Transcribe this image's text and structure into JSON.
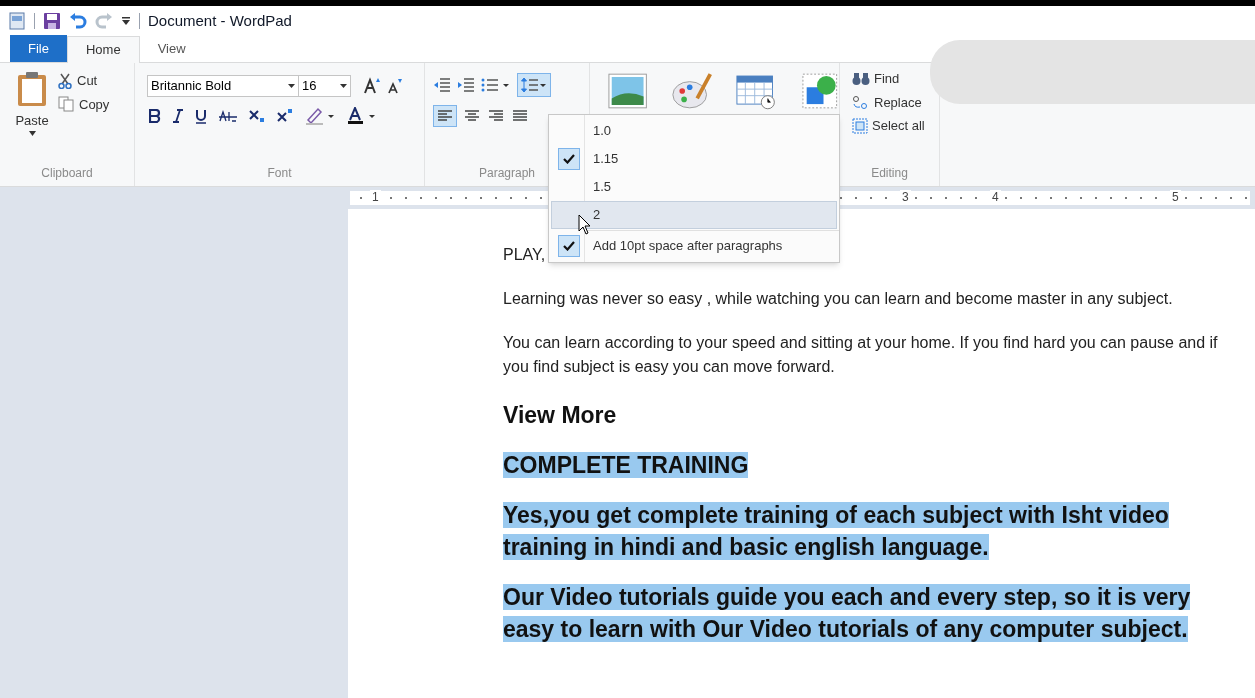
{
  "window": {
    "title": "Document - WordPad"
  },
  "tabs": [
    {
      "label": "File",
      "kind": "file",
      "selected": false
    },
    {
      "label": "Home",
      "kind": "tab",
      "selected": true
    },
    {
      "label": "View",
      "kind": "tab",
      "selected": false
    }
  ],
  "ribbon": {
    "clipboard": {
      "paste": "Paste",
      "cut": "Cut",
      "copy": "Copy",
      "label": "Clipboard"
    },
    "font": {
      "family": "Britannic Bold",
      "size": "16",
      "label": "Font"
    },
    "paragraph": {
      "label": "Paragraph"
    },
    "editing": {
      "find": "Find",
      "replace": "Replace",
      "select_all": "Select all",
      "label": "Editing"
    }
  },
  "ruler": {
    "numbers": [
      "1",
      "3",
      "4",
      "5"
    ]
  },
  "line_spacing_menu": {
    "items": [
      {
        "label": "1.0",
        "checked": false,
        "hovered": false
      },
      {
        "label": "1.15",
        "checked": true,
        "hovered": false
      },
      {
        "label": "1.5",
        "checked": false,
        "hovered": false
      },
      {
        "label": "2",
        "checked": false,
        "hovered": true
      }
    ],
    "option": {
      "label": "Add 10pt space after paragraphs",
      "checked": true
    }
  },
  "document": {
    "paragraphs": [
      {
        "kind": "body",
        "text": "PLAY,",
        "selected": false
      },
      {
        "kind": "body",
        "text": "Learning was never so easy , while watching you can learn and become master in any subject.",
        "selected": false
      },
      {
        "kind": "body",
        "text": "You can learn according to your speed and sitting at your home. If you find hard you can pause and if you find subject is easy you can move forward.",
        "selected": false
      },
      {
        "kind": "heading",
        "text": "View More",
        "selected": false
      },
      {
        "kind": "heading",
        "text": "COMPLETE TRAINING",
        "selected": true
      },
      {
        "kind": "heading",
        "text": "Yes,you get complete training of each subject with Isht video training in hindi and basic english language.",
        "selected": true
      },
      {
        "kind": "heading",
        "text": "Our Video tutorials guide you each and every step, so it is very easy to learn with Our Video tutorials of any computer subject.",
        "selected": true
      }
    ]
  }
}
